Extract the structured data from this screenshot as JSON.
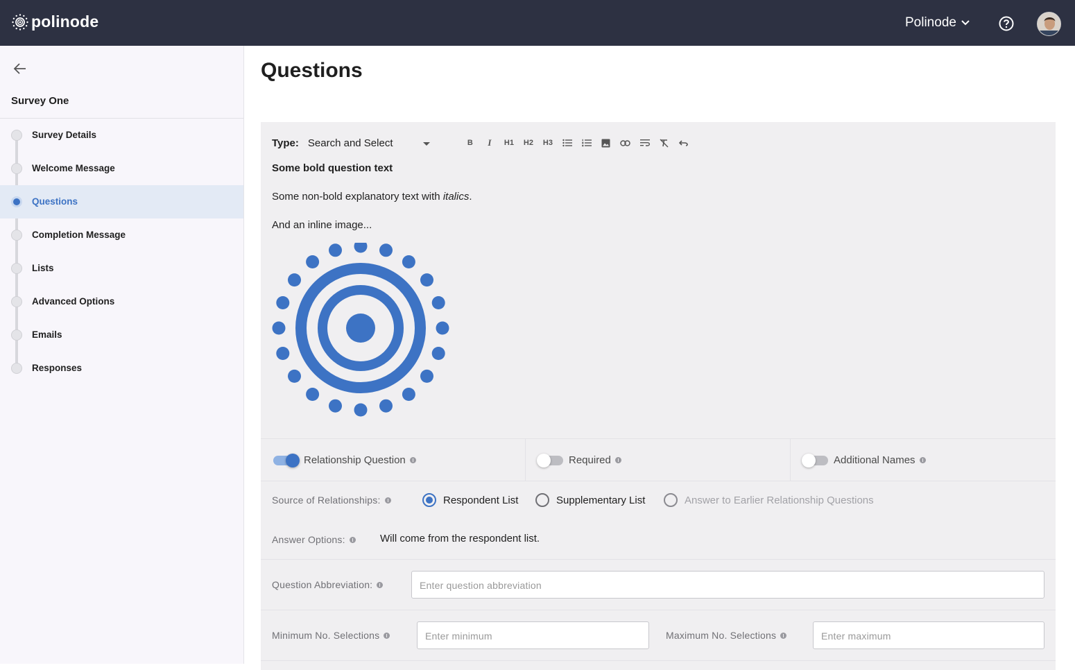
{
  "app": {
    "brand": "polinode",
    "org_name": "Polinode"
  },
  "sidebar": {
    "survey_name": "Survey One",
    "items": [
      {
        "label": "Survey Details"
      },
      {
        "label": "Welcome Message"
      },
      {
        "label": "Questions",
        "active": true
      },
      {
        "label": "Completion Message"
      },
      {
        "label": "Lists"
      },
      {
        "label": "Advanced Options"
      },
      {
        "label": "Emails"
      },
      {
        "label": "Responses"
      }
    ]
  },
  "main": {
    "title": "Questions",
    "toolbar": {
      "type_label": "Type:",
      "type_value": "Search and Select",
      "buttons": [
        "B",
        "I",
        "H1",
        "H2",
        "H3",
        "bullet-list-icon",
        "numbered-list-icon",
        "image-icon",
        "link-icon",
        "wrap-text-icon",
        "clear-format-icon",
        "undo-icon"
      ]
    },
    "editor": {
      "bold_text": "Some bold question text",
      "explanatory_prefix": "Some non-bold explanatory text with ",
      "explanatory_italic": "italics",
      "explanatory_suffix": ".",
      "image_caption": "And an inline image..."
    },
    "toggles": {
      "relationship": {
        "label": "Relationship Question",
        "on": true
      },
      "required": {
        "label": "Required",
        "on": false
      },
      "additional_names": {
        "label": "Additional Names",
        "on": false
      }
    },
    "source": {
      "label": "Source of Relationships:",
      "options": [
        {
          "label": "Respondent List",
          "selected": true
        },
        {
          "label": "Supplementary List",
          "selected": false
        },
        {
          "label": "Answer to Earlier Relationship Questions",
          "disabled": true
        }
      ]
    },
    "answer_options": {
      "label": "Answer Options:",
      "value": "Will come from the respondent list."
    },
    "abbreviation": {
      "label": "Question Abbreviation:",
      "placeholder": "Enter question abbreviation"
    },
    "min_selections": {
      "label": "Minimum No. Selections",
      "placeholder": "Enter minimum"
    },
    "max_selections": {
      "label": "Maximum No. Selections",
      "placeholder": "Enter maximum"
    }
  },
  "colors": {
    "topbar": "#2d3142",
    "accent": "#3d73c4",
    "card": "#f0eff1"
  }
}
